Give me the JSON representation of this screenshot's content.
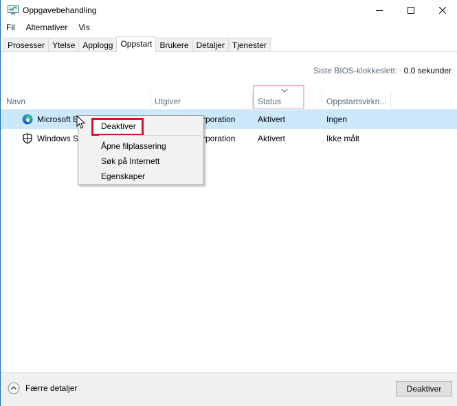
{
  "window": {
    "title": "Oppgavebehandling",
    "controls": {
      "minimize": "—",
      "maximize": "☐",
      "close": "✕"
    }
  },
  "menubar": [
    {
      "label": "Fil"
    },
    {
      "label": "Alternativer"
    },
    {
      "label": "Vis"
    }
  ],
  "tabs": [
    {
      "label": "Prosesser",
      "active": false
    },
    {
      "label": "Ytelse",
      "active": false
    },
    {
      "label": "Applogg",
      "active": false
    },
    {
      "label": "Oppstart",
      "active": true
    },
    {
      "label": "Brukere",
      "active": false
    },
    {
      "label": "Detaljer",
      "active": false
    },
    {
      "label": "Tjenester",
      "active": false
    }
  ],
  "bios": {
    "label": "Siste BIOS-klokkeslett:",
    "value": "0.0 sekunder"
  },
  "table": {
    "columns": [
      "Navn",
      "Utgiver",
      "Status",
      "Oppstartsvirkn..."
    ],
    "sorted_column": "Status",
    "rows": [
      {
        "name": "Microsoft E",
        "publisher": "rporation",
        "status": "Aktivert",
        "impact": "Ingen",
        "icon": "edge-icon",
        "selected": true
      },
      {
        "name": "Windows S",
        "publisher": "rporation",
        "status": "Aktivert",
        "impact": "Ikke målt",
        "icon": "shield-icon",
        "selected": false
      }
    ]
  },
  "context_menu": {
    "items": [
      "Deaktiver",
      "Åpne filplassering",
      "Søk på Internett",
      "Egenskaper"
    ]
  },
  "footer": {
    "fewer_details": "Færre detaljer",
    "deactivate_button": "Deaktiver"
  },
  "colors": {
    "selection": "#cce8ff",
    "highlight_red": "#d1132c",
    "header_text": "#5a6b7a"
  }
}
